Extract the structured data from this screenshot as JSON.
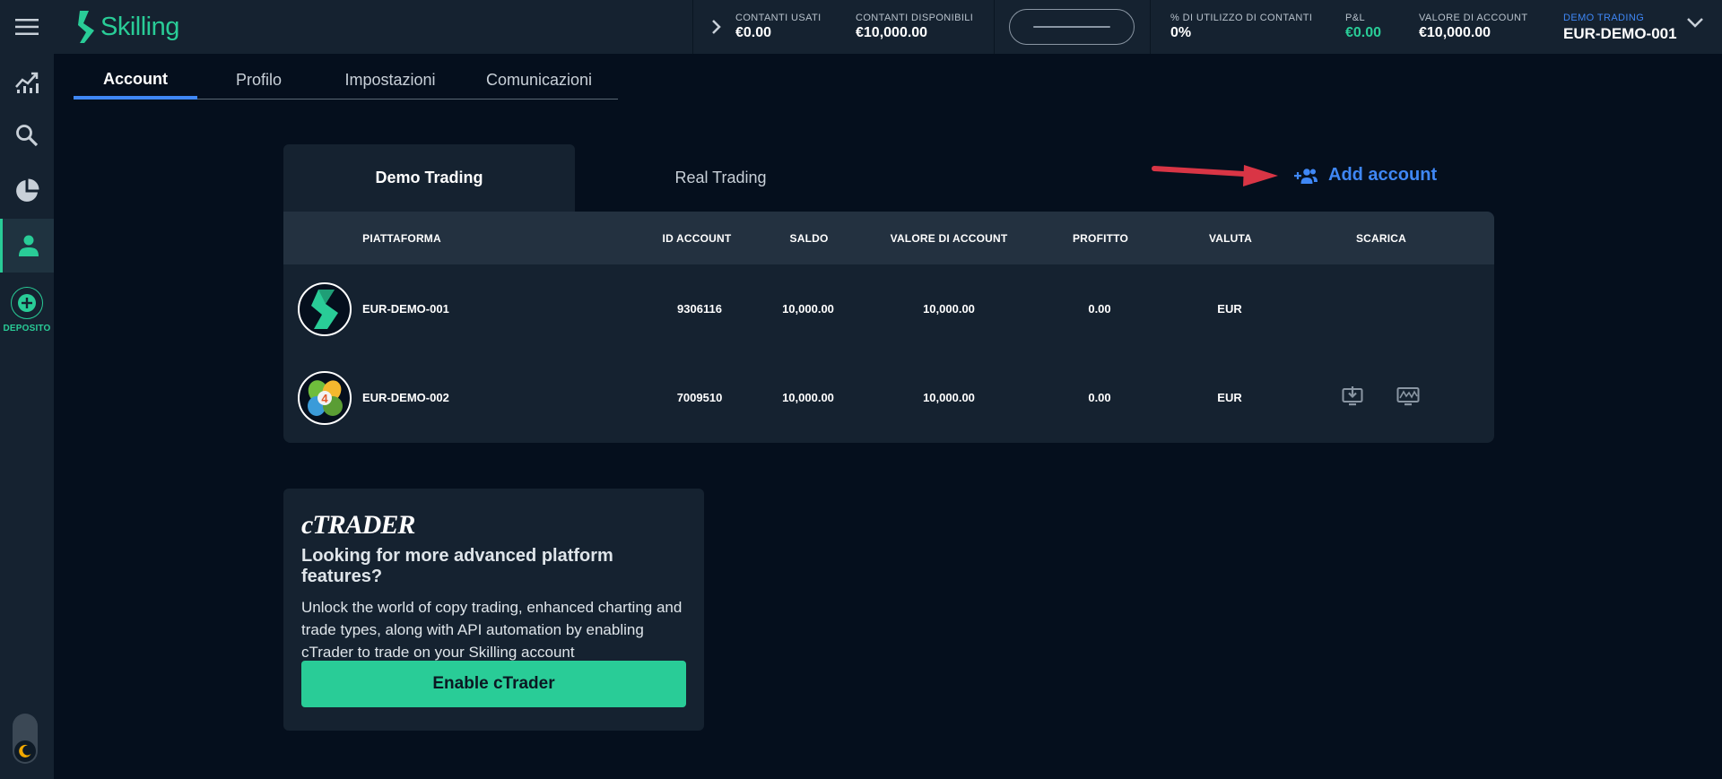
{
  "brand": {
    "name": "Skilling",
    "accent": "#29cc97"
  },
  "sidebar": {
    "items": [
      {
        "name": "menu-icon"
      },
      {
        "name": "chart-trend-icon"
      },
      {
        "name": "search-icon"
      },
      {
        "name": "pie-chart-icon"
      },
      {
        "name": "account-user-icon",
        "active": true
      }
    ],
    "deposit_label": "DEPOSITO"
  },
  "topbar": {
    "stats": [
      {
        "label": "CONTANTI USATI",
        "value": "€0.00"
      },
      {
        "label": "CONTANTI DISPONIBILI",
        "value": "€10,000.00"
      },
      {
        "label": "% DI UTILIZZO DI CONTANTI",
        "value": "0%"
      },
      {
        "label": "P&L",
        "value": "€0.00"
      },
      {
        "label": "VALORE DI ACCOUNT",
        "value": "€10,000.00"
      }
    ],
    "account": {
      "label": "DEMO TRADING",
      "value": "EUR-DEMO-001"
    }
  },
  "page_tabs": [
    "Account",
    "Profilo",
    "Impostazioni",
    "Comunicazioni"
  ],
  "trading_tabs": {
    "demo": "Demo Trading",
    "real": "Real Trading"
  },
  "add_account_label": "Add account",
  "table": {
    "headers": [
      "PIATTAFORMA",
      "ID ACCOUNT",
      "SALDO",
      "VALORE DI ACCOUNT",
      "PROFITTO",
      "VALUTA",
      "SCARICA"
    ],
    "rows": [
      {
        "platform": "EUR-DEMO-001",
        "id": "9306116",
        "balance": "10,000.00",
        "value": "10,000.00",
        "profit": "0.00",
        "currency": "EUR"
      },
      {
        "platform": "EUR-DEMO-002",
        "id": "7009510",
        "balance": "10,000.00",
        "value": "10,000.00",
        "profit": "0.00",
        "currency": "EUR"
      }
    ]
  },
  "ctrader_card": {
    "logo": "cTRADER",
    "title": "Looking for more advanced platform features?",
    "body": "Unlock the world of copy trading, enhanced charting and trade types, along with API automation by enabling cTrader to trade on your Skilling account",
    "button": "Enable cTrader"
  }
}
